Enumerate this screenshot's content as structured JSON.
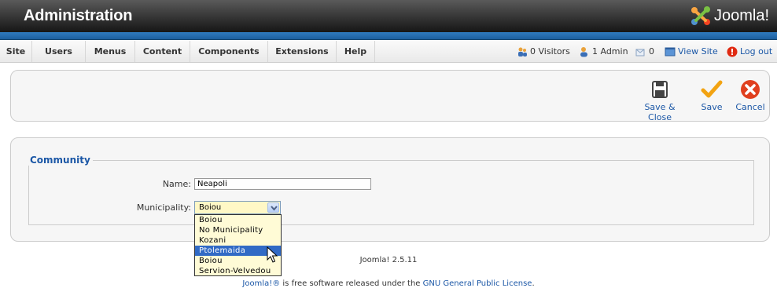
{
  "header": {
    "title": "Administration",
    "logo_text": "Joomla!"
  },
  "menu": {
    "items": [
      {
        "label": "Site"
      },
      {
        "label": "Users"
      },
      {
        "label": "Menus"
      },
      {
        "label": "Content"
      },
      {
        "label": "Components"
      },
      {
        "label": "Extensions"
      },
      {
        "label": "Help"
      }
    ]
  },
  "status": {
    "visitors": "0 Visitors",
    "admin": "1 Admin",
    "messages": "0",
    "view_site": "View Site",
    "logout": "Log out"
  },
  "toolbar": {
    "save_close": "Save & Close",
    "save": "Save",
    "cancel": "Cancel"
  },
  "form": {
    "legend": "Community",
    "name_label": "Name:",
    "name_value": "Neapoli",
    "municipality_label": "Municipality:",
    "municipality_selected": "Boiou",
    "options": [
      "Boiou",
      "No Municipality",
      "Kozani",
      "Ptolemaida",
      "Boiou",
      "Servion-Velvedou"
    ],
    "highlighted_option": "Ptolemaida"
  },
  "footer": {
    "version": "Joomla! 2.5.11",
    "license_prefix": "Joomla!®",
    "license_middle": " is free software released under the ",
    "license_link": "GNU General Public License",
    "license_suffix": "."
  },
  "colors": {
    "accent": "#1b57a6",
    "header_bar": "#1d5f9e",
    "selection": "#316ac5"
  }
}
